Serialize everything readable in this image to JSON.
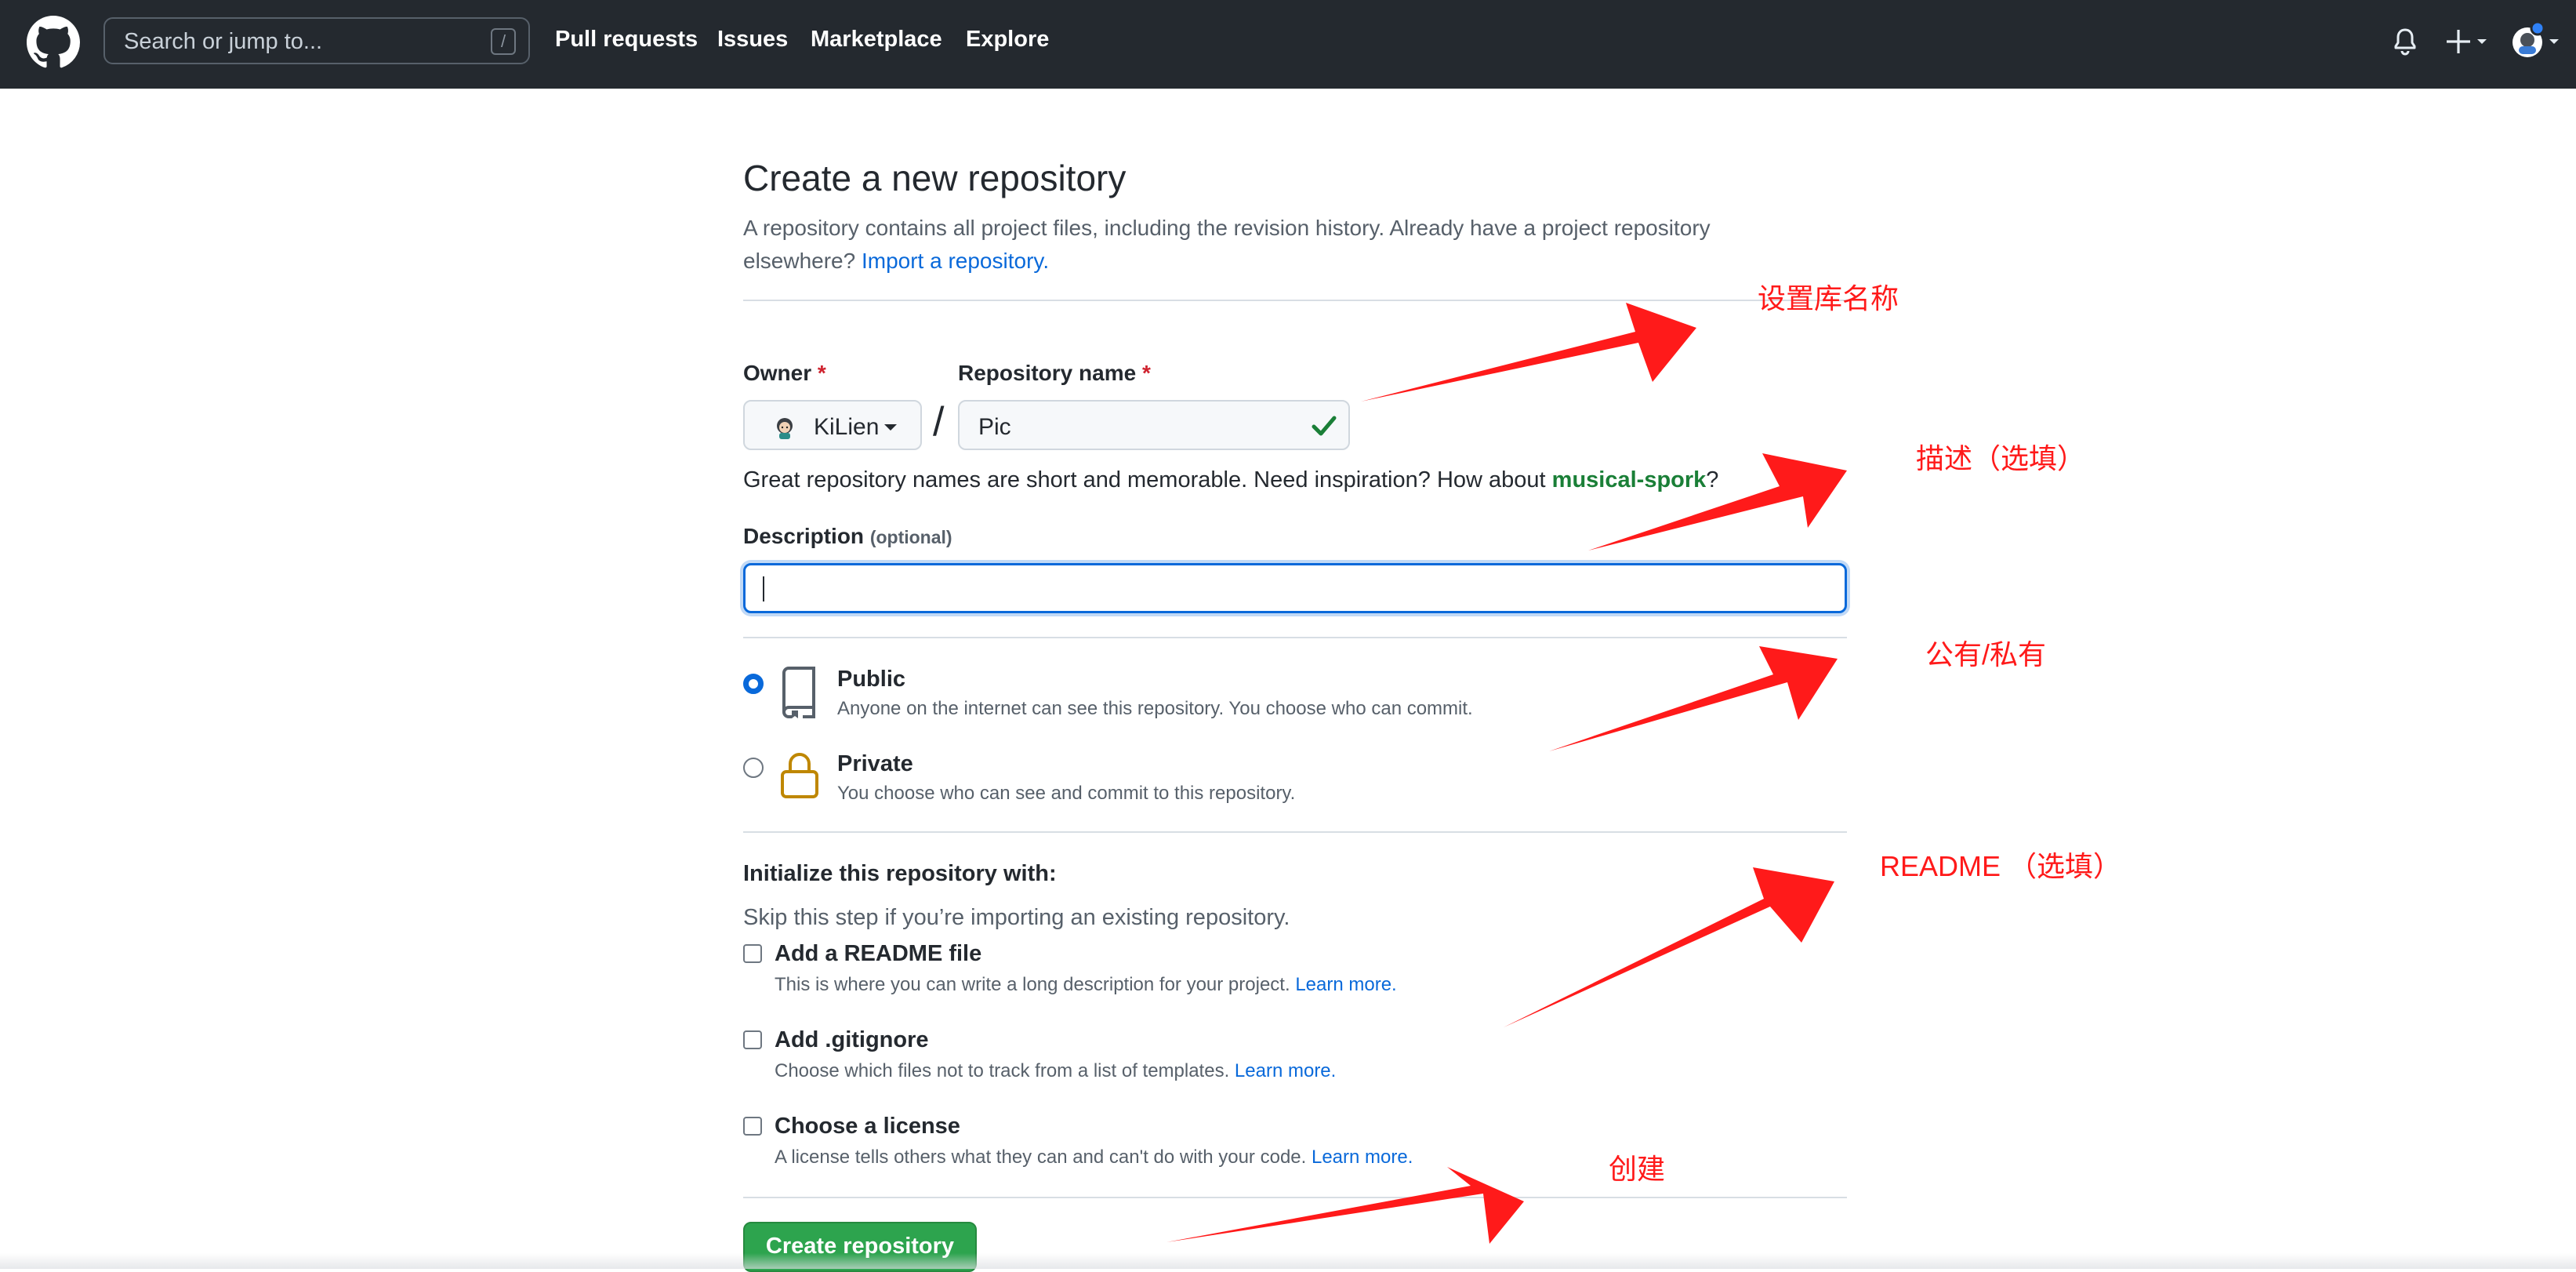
{
  "header": {
    "search_placeholder": "Search or jump to...",
    "search_shortcut": "/",
    "nav": [
      "Pull requests",
      "Issues",
      "Marketplace",
      "Explore"
    ]
  },
  "page": {
    "title": "Create a new repository",
    "intro": "A repository contains all project files, including the revision history. Already have a project repository elsewhere?",
    "import_link": "Import a repository.",
    "owner_label": "Owner",
    "owner_value": "KiLien",
    "repo_label": "Repository name",
    "repo_value": "Pic",
    "separator": "/",
    "required_mark": "*",
    "hint_prefix": "Great repository names are short and memorable. Need inspiration? How about",
    "hint_suggestion": "musical-spork",
    "hint_suffix": "?",
    "description_label": "Description",
    "description_optional": "(optional)",
    "description_value": ""
  },
  "visibility": {
    "public": {
      "title": "Public",
      "desc": "Anyone on the internet can see this repository. You choose who can commit.",
      "selected": true
    },
    "private": {
      "title": "Private",
      "desc": "You choose who can see and commit to this repository.",
      "selected": false
    }
  },
  "init": {
    "title": "Initialize this repository with:",
    "subtitle": "Skip this step if you’re importing an existing repository.",
    "readme": {
      "title": "Add a README file",
      "desc": "This is where you can write a long description for your project.",
      "link": "Learn more."
    },
    "gitignore": {
      "title": "Add .gitignore",
      "desc": "Choose which files not to track from a list of templates.",
      "link": "Learn more."
    },
    "license": {
      "title": "Choose a license",
      "desc": "A license tells others what they can and can't do with your code.",
      "link": "Learn more."
    }
  },
  "actions": {
    "create": "Create repository"
  },
  "annotations": {
    "name": "设置库名称",
    "description": "描述（选填）",
    "visibility": "公有/私有",
    "readme": "README （选填）",
    "create": "创建"
  },
  "colors": {
    "header_bg": "#24292f",
    "link": "#0969da",
    "primary_button": "#2da44e",
    "annotation": "#ff1a1a",
    "success": "#1a7f37"
  }
}
